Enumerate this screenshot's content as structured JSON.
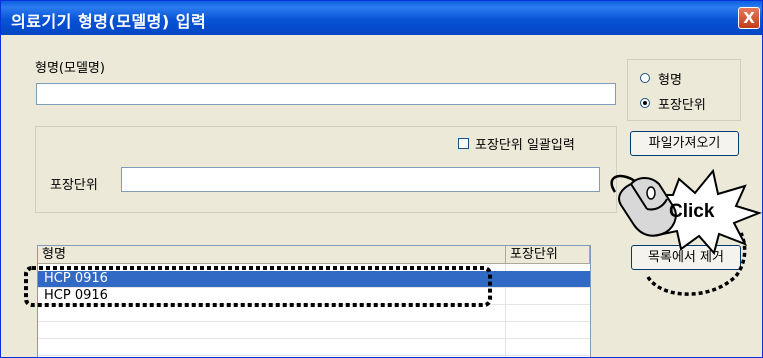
{
  "window": {
    "title": "의료기기 형명(모델명) 입력",
    "close_glyph": "X"
  },
  "model_field": {
    "label": "형명(모델명)",
    "value": ""
  },
  "mode_group": {
    "options": [
      {
        "label": "형명",
        "selected": false
      },
      {
        "label": "포장단위",
        "selected": true
      }
    ]
  },
  "import_button": {
    "label": "파일가져오기"
  },
  "bulk_checkbox": {
    "label": "포장단위 일괄입력",
    "checked": false
  },
  "package_field": {
    "label": "포장단위",
    "value": ""
  },
  "remove_button": {
    "label": "목록에서 제거"
  },
  "list": {
    "columns": [
      "형명",
      "포장단위"
    ],
    "rows": [
      {
        "model": "HCP 0916",
        "package": "",
        "selected": true
      },
      {
        "model": "HCP 0916",
        "package": "",
        "selected": false
      },
      {
        "model": "",
        "package": "",
        "selected": false
      },
      {
        "model": "",
        "package": "",
        "selected": false
      },
      {
        "model": "",
        "package": "",
        "selected": false
      },
      {
        "model": "",
        "package": "",
        "selected": false
      }
    ]
  },
  "annotation": {
    "click_text": "Click",
    "highlight_color": "#000000",
    "selection_color": "#316ac5"
  }
}
